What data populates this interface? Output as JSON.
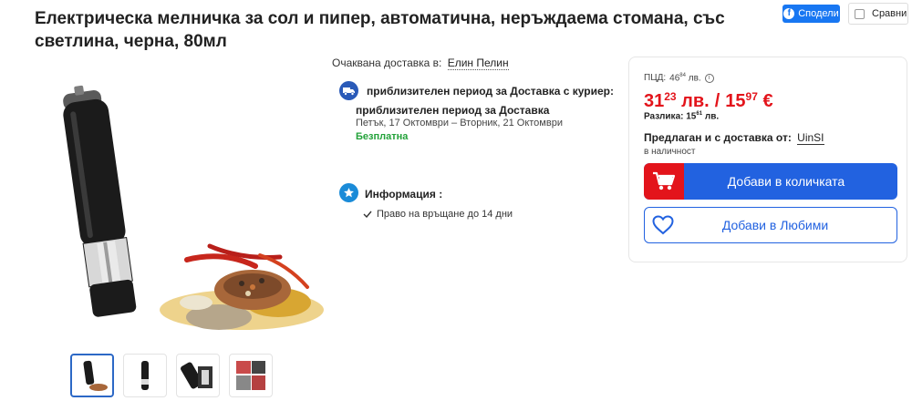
{
  "product": {
    "title": "Електрическа мелничка за сол и пипер, автоматична, неръждаема стомана, със светлина, черна, 80мл"
  },
  "actions": {
    "share_label": "Сподели",
    "compare_label": "Сравни"
  },
  "delivery": {
    "expected_label": "Очаквана доставка в:",
    "location": "Елин Пелин",
    "courier_title": "приблизителен период за Доставка с куриер:",
    "period_title": "приблизителен период за Доставка",
    "period_dates": "Петък, 17 Октомври – Вторник, 21 Октомври",
    "price": "Безплатна"
  },
  "info": {
    "title": "Информация :",
    "return_policy": "Право на връщане до 14 дни"
  },
  "pricing": {
    "pcd_label": "ПЦД:",
    "pcd_int": "46",
    "pcd_dec": "84",
    "pcd_currency": "лв.",
    "price_bgn_int": "31",
    "price_bgn_dec": "23",
    "price_bgn_currency": "лв.",
    "separator": "/",
    "price_eur_int": "15",
    "price_eur_dec": "97",
    "price_eur_currency": "€",
    "diff_label": "Разлика:",
    "diff_int": "15",
    "diff_dec": "61",
    "diff_currency": "лв.",
    "seller_label": "Предлаган и с доставка от:",
    "seller_name": "UinSI",
    "stock_status": "в наличност"
  },
  "buttons": {
    "add_to_cart": "Добави в количката",
    "add_to_favorites": "Добави в Любими"
  },
  "colors": {
    "price_red": "#e3141b",
    "primary_blue": "#2262e0",
    "free_green": "#23a23a",
    "facebook_blue": "#1877f2"
  },
  "icons": {
    "share": "facebook-icon",
    "courier": "truck-icon",
    "info": "star-icon",
    "return": "check-icon",
    "cart": "cart-icon",
    "favorite": "heart-icon",
    "pcd_info": "info-icon"
  },
  "gallery": {
    "thumbnail_count": 4,
    "active_index": 0
  }
}
